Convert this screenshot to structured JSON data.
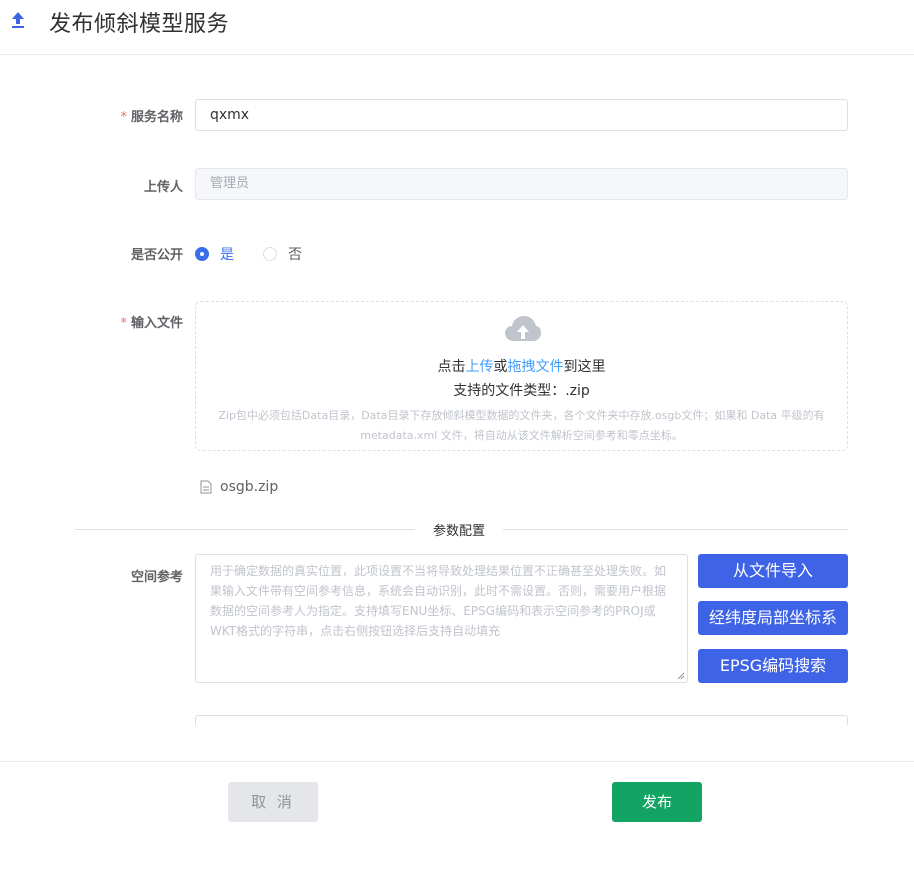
{
  "header": {
    "title": "发布倾斜模型服务",
    "icon": "upload-arrow-icon"
  },
  "form": {
    "service_name": {
      "label": "服务名称",
      "required_mark": "*",
      "value": "qxmx"
    },
    "uploader": {
      "label": "上传人",
      "placeholder": "管理员"
    },
    "public": {
      "label": "是否公开",
      "options": [
        {
          "label": "是",
          "checked": true
        },
        {
          "label": "否",
          "checked": false
        }
      ]
    },
    "input_file": {
      "label": "输入文件",
      "required_mark": "*",
      "dropzone": {
        "icon": "cloud-upload-icon",
        "text_prefix": "点击",
        "link_upload": "上传",
        "text_or": "或",
        "link_drag": "拖拽文件",
        "text_suffix": "到这里",
        "types": "支持的文件类型：.zip",
        "hint": "Zip包中必须包括Data目录，Data目录下存放倾斜模型数据的文件夹，各个文件夹中存放.osgb文件；如果和 Data 平级的有 metadata.xml 文件，将自动从该文件解析空间参考和零点坐标。"
      },
      "uploaded_file": "osgb.zip"
    },
    "params_divider": "参数配置",
    "spatial_ref": {
      "label": "空间参考",
      "placeholder": "用于确定数据的真实位置，此项设置不当将导致处理结果位置不正确甚至处理失败。如果输入文件带有空间参考信息，系统会自动识别，此时不需设置。否则，需要用户根据数据的空间参考人为指定。支持填写ENU坐标、EPSG编码和表示空间参考的PROJ或WKT格式的字符串，点击右侧按钮选择后支持自动填充",
      "buttons": [
        "从文件导入",
        "经纬度局部坐标系",
        "EPSG编码搜索"
      ]
    }
  },
  "footer": {
    "cancel_label": "取 消",
    "publish_label": "发布"
  },
  "colors": {
    "primary": "#3f63e6",
    "publish": "#13a463",
    "required": "#f56c6c",
    "link": "#409eff"
  }
}
